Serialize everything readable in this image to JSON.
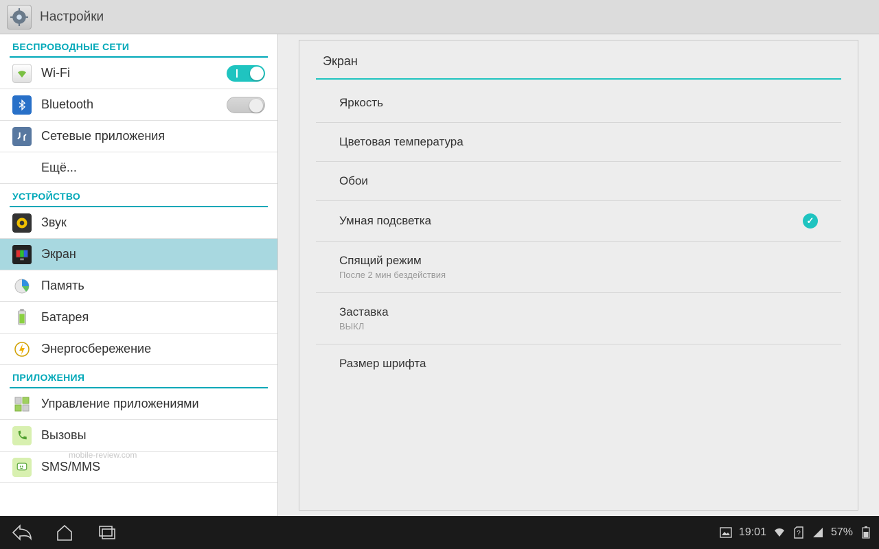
{
  "header": {
    "title": "Настройки"
  },
  "sidebar": {
    "sections": [
      {
        "title": "БЕСПРОВОДНЫЕ СЕТИ",
        "items": [
          {
            "label": "Wi-Fi",
            "toggle": true,
            "toggle_on": true,
            "icon": "wifi-icon"
          },
          {
            "label": "Bluetooth",
            "toggle": true,
            "toggle_on": false,
            "icon": "bluetooth-icon"
          },
          {
            "label": "Сетевые приложения",
            "icon": "network-apps-icon"
          },
          {
            "label": "Ещё...",
            "indent": true
          }
        ]
      },
      {
        "title": "УСТРОЙСТВО",
        "items": [
          {
            "label": "Звук",
            "icon": "sound-icon"
          },
          {
            "label": "Экран",
            "icon": "display-icon",
            "selected": true
          },
          {
            "label": "Память",
            "icon": "memory-icon"
          },
          {
            "label": "Батарея",
            "icon": "battery-icon"
          },
          {
            "label": "Энергосбережение",
            "icon": "energy-icon"
          }
        ]
      },
      {
        "title": "ПРИЛОЖЕНИЯ",
        "items": [
          {
            "label": "Управление приложениями",
            "icon": "apps-icon"
          },
          {
            "label": "Вызовы",
            "icon": "calls-icon"
          },
          {
            "label": "SMS/MMS",
            "icon": "sms-icon"
          }
        ]
      }
    ]
  },
  "detail": {
    "title": "Экран",
    "rows": [
      {
        "primary": "Яркость"
      },
      {
        "primary": "Цветовая температура"
      },
      {
        "primary": "Обои"
      },
      {
        "primary": "Умная подсветка",
        "checked": true
      },
      {
        "primary": "Спящий режим",
        "secondary": "После 2 мин бездействия"
      },
      {
        "primary": "Заставка",
        "secondary": "ВЫКЛ"
      },
      {
        "primary": "Размер шрифта"
      }
    ]
  },
  "statusbar": {
    "time": "19:01",
    "battery_text": "57%"
  },
  "watermark": "mobile-review.com",
  "colors": {
    "accent": "#1fc4c0",
    "section": "#00a8b8"
  }
}
